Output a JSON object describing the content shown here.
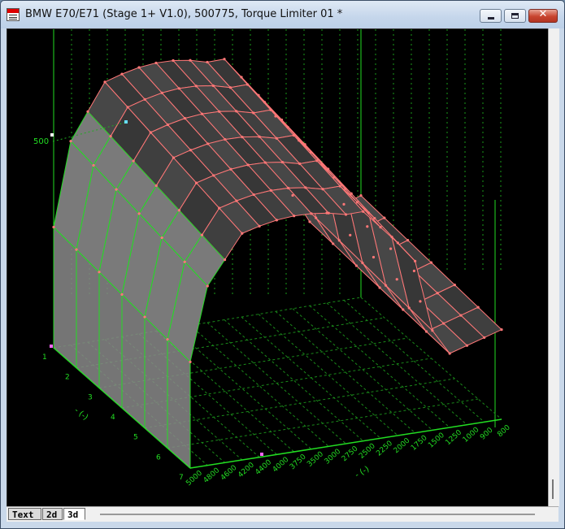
{
  "window": {
    "title": "BMW E70/E71 (Stage 1+ V1.0), 500775, Torque Limiter 01 *",
    "close_symbol": "✕"
  },
  "tabs": [
    {
      "label": "Text",
      "active": false
    },
    {
      "label": "2d",
      "active": false
    },
    {
      "label": "3d",
      "active": true
    }
  ],
  "plot": {
    "z_tick_label": "500",
    "row_axis_labels": [
      "1",
      "2",
      "3",
      "4",
      "5",
      "6",
      "7"
    ],
    "row_axis_title": "- (-)",
    "rpm_labels": [
      "5000",
      "4800",
      "4600",
      "4200",
      "4400",
      "4000",
      "3750",
      "3500",
      "3000",
      "2750",
      "2500",
      "2250",
      "2000",
      "1750",
      "1500",
      "1250",
      "1000",
      "900",
      "800"
    ],
    "rpm_axis_title": "- (-)",
    "colors": {
      "surface_edges": "#ff7777",
      "grid": "#22dd22",
      "background": "#000000",
      "shade": "#6a6a6a"
    }
  }
}
